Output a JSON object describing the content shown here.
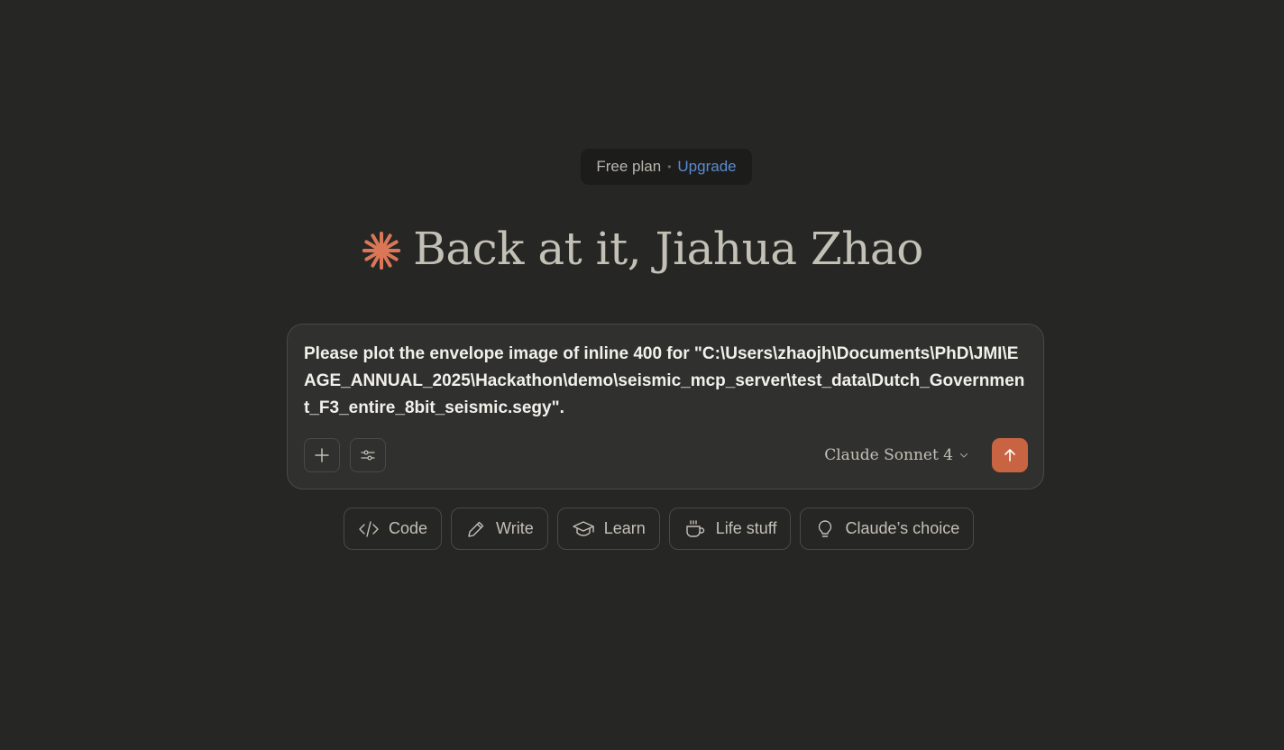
{
  "plan": {
    "label": "Free plan",
    "separator": "•",
    "upgrade_label": "Upgrade"
  },
  "greeting": {
    "text": "Back at it, Jiahua Zhao",
    "icon": "claude-spark-icon",
    "icon_color": "#d97757"
  },
  "composer": {
    "value": "Please plot the envelope image of inline 400 for \"C:\\Users\\zhaojh\\Documents\\PhD\\JMI\\EAGE_ANNUAL_2025\\Hackathon\\demo\\seismic_mcp_server\\test_data\\Dutch_Government_F3_entire_8bit_seismic.segy\".",
    "add_icon": "plus-icon",
    "tools_icon": "sliders-icon",
    "model_label": "Claude Sonnet 4",
    "send_icon": "arrow-up-icon",
    "send_color": "#c96442"
  },
  "chips": [
    {
      "label": "Code",
      "icon": "code-icon"
    },
    {
      "label": "Write",
      "icon": "pencil-icon"
    },
    {
      "label": "Learn",
      "icon": "graduation-cap-icon"
    },
    {
      "label": "Life stuff",
      "icon": "coffee-cup-icon"
    },
    {
      "label": "Claude’s choice",
      "icon": "lightbulb-icon"
    }
  ]
}
